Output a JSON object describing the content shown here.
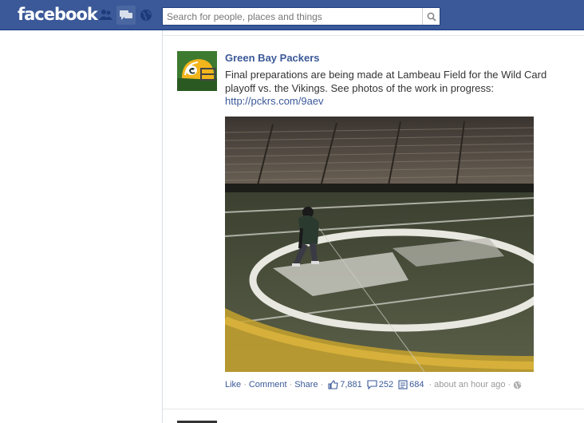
{
  "header": {
    "logo": "facebook",
    "search_placeholder": "Search for people, places and things"
  },
  "post": {
    "author": "Green Bay Packers",
    "message": "Final preparations are being made at Lambeau Field for the Wild Card playoff vs. the Vikings. See photos of the work in progress:",
    "link": "http://pckrs.com/9aev",
    "actions": {
      "like": "Like",
      "comment": "Comment",
      "share": "Share",
      "likes_count": "7,881",
      "comments_count": "252",
      "shares_count": "684",
      "timestamp": "about an hour ago",
      "separator": "·"
    }
  },
  "colors": {
    "brand": "#3b5998",
    "text": "#333333",
    "muted": "#999999"
  },
  "icons": [
    "friend-requests-icon",
    "messages-icon",
    "notifications-globe-icon",
    "search-icon",
    "thumbs-up-icon",
    "comment-icon",
    "share-icon",
    "public-globe-icon"
  ]
}
